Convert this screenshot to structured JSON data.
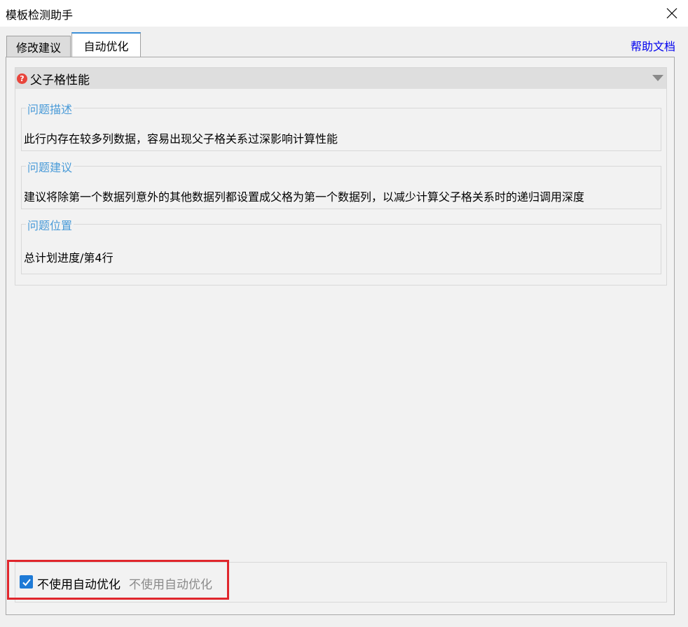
{
  "window": {
    "title": "模板检测助手"
  },
  "tabs": [
    {
      "label": "修改建议"
    },
    {
      "label": "自动优化"
    }
  ],
  "help_link": "帮助文档",
  "issue": {
    "title": "父子格性能",
    "description": {
      "legend": "问题描述",
      "text": "此行内存在较多列数据，容易出现父子格关系过深影响计算性能"
    },
    "suggestion": {
      "legend": "问题建议",
      "text": "建议将除第一个数据列意外的其他数据列都设置成父格为第一个数据列，以减少计算父子格关系时的递归调用深度"
    },
    "location": {
      "legend": "问题位置",
      "text": "总计划进度/第4行"
    }
  },
  "auto_optimize": {
    "checkbox_label": "不使用自动优化",
    "hint_text": "不使用自动优化",
    "checked": true
  },
  "colors": {
    "accent": "#3a8fd8",
    "legend": "#4a9bd8",
    "link": "#0000ee",
    "highlight_border": "#e0262c",
    "checkbox": "#1e7ad6"
  },
  "icons": [
    "close-icon",
    "question-icon",
    "chevron-down-icon",
    "checkmark-icon"
  ]
}
